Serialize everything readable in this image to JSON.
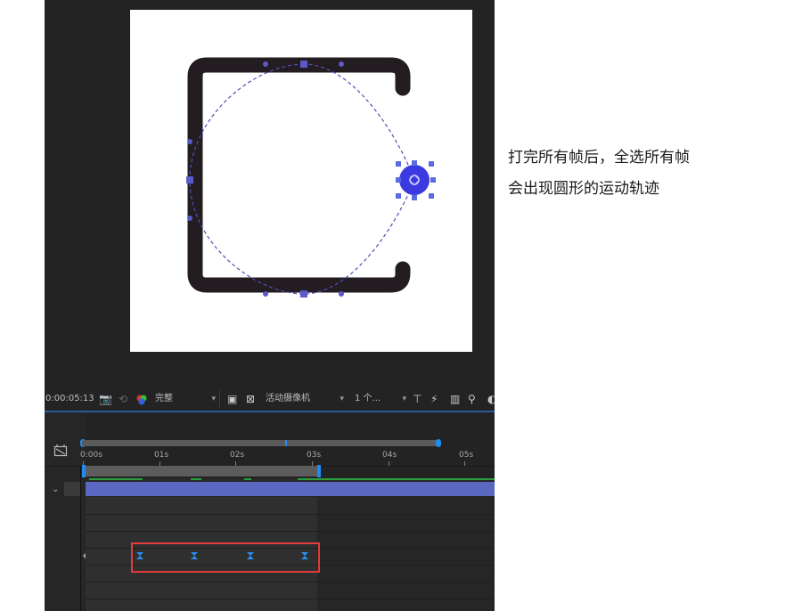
{
  "toolbar": {
    "timecode": "0:00:05:13",
    "resolution": "完整",
    "camera": "活动摄像机",
    "views": "1 个..."
  },
  "ruler": {
    "ticks": [
      "0:00s",
      "01s",
      "02s",
      "03s",
      "04s",
      "05s"
    ]
  },
  "caption": {
    "line1": "打完所有帧后，全选所有帧",
    "line2": "会出现圆形的运动轨迹"
  },
  "colors": {
    "shape": "#231c20",
    "motion_path": "#4a4ab8",
    "layer_bar": "#5a68c2",
    "accent": "#1f8cf0",
    "highlight": "#e23b3b"
  }
}
